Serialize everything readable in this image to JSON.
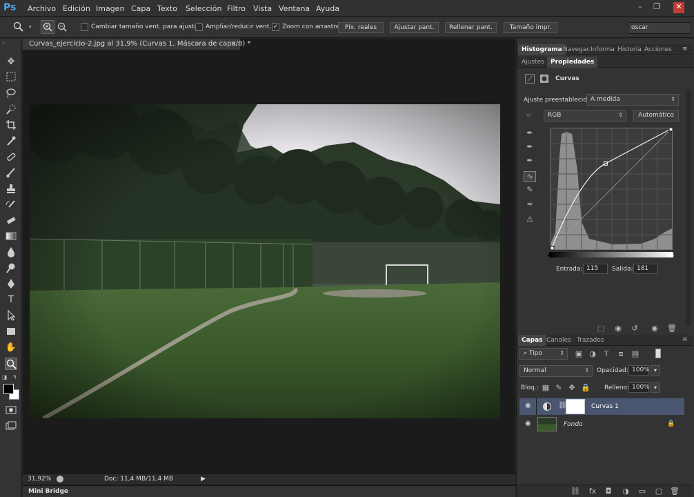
{
  "app": {
    "logo": "Ps"
  },
  "menu": [
    "Archivo",
    "Edición",
    "Imagen",
    "Capa",
    "Texto",
    "Selección",
    "Filtro",
    "Vista",
    "Ventana",
    "Ayuda"
  ],
  "window_controls": {
    "minimize": "–",
    "restore": "❐",
    "close": "✕"
  },
  "options": {
    "resize_windows_label": "Cambiar tamaño vent. para ajustar",
    "resize_windows_checked": false,
    "zoom_all_label": "Ampliar/reducir vent.",
    "zoom_all_checked": false,
    "scrubby_label": "Zoom con arrastre",
    "scrubby_checked": true,
    "actual_pixels": "Píx. reales",
    "fit_screen": "Ajustar pant.",
    "fill_screen": "Rellenar pant.",
    "print_size": "Tamaño impr.",
    "workspace_search": "oscar"
  },
  "document": {
    "tab_title": "Curvas_ejercicio-2.jpg al 31,9% (Curvas 1, Máscara de capa/8) *",
    "close": "×",
    "zoom": "31,92%",
    "doc_info": "Doc: 11,4 MB/11,4 MB"
  },
  "minibridge": "Mini Bridge",
  "panels_top": {
    "tabs": [
      "Histograma",
      "Navegac",
      "Informa",
      "Historia",
      "Acciones"
    ],
    "active": "Histograma"
  },
  "properties": {
    "tabs": [
      "Ajustes",
      "Propiedades"
    ],
    "active": "Propiedades",
    "title": "Curvas",
    "preset_label": "Ajuste preestablecido:",
    "preset_value": "A medida",
    "channel": "RGB",
    "auto_button": "Automático",
    "input_label": "Entrada:",
    "input_value": "115",
    "output_label": "Salida:",
    "output_value": "181",
    "curve_point": {
      "input": 115,
      "output": 181
    }
  },
  "layers_panel": {
    "tabs": [
      "Capas",
      "Canales",
      "Trazados"
    ],
    "active": "Capas",
    "filter": "Tipo",
    "blend_mode": "Normal",
    "opacity_label": "Opacidad:",
    "opacity_value": "100%",
    "lock_label": "Bloq.:",
    "fill_label": "Relleno:",
    "fill_value": "100%",
    "layers": [
      {
        "name": "Curvas 1",
        "selected": true
      },
      {
        "name": "Fondo",
        "selected": false,
        "locked": true
      }
    ]
  },
  "colors": {
    "accent": "#4fa8e8",
    "selected_layer": "#4a5570"
  }
}
